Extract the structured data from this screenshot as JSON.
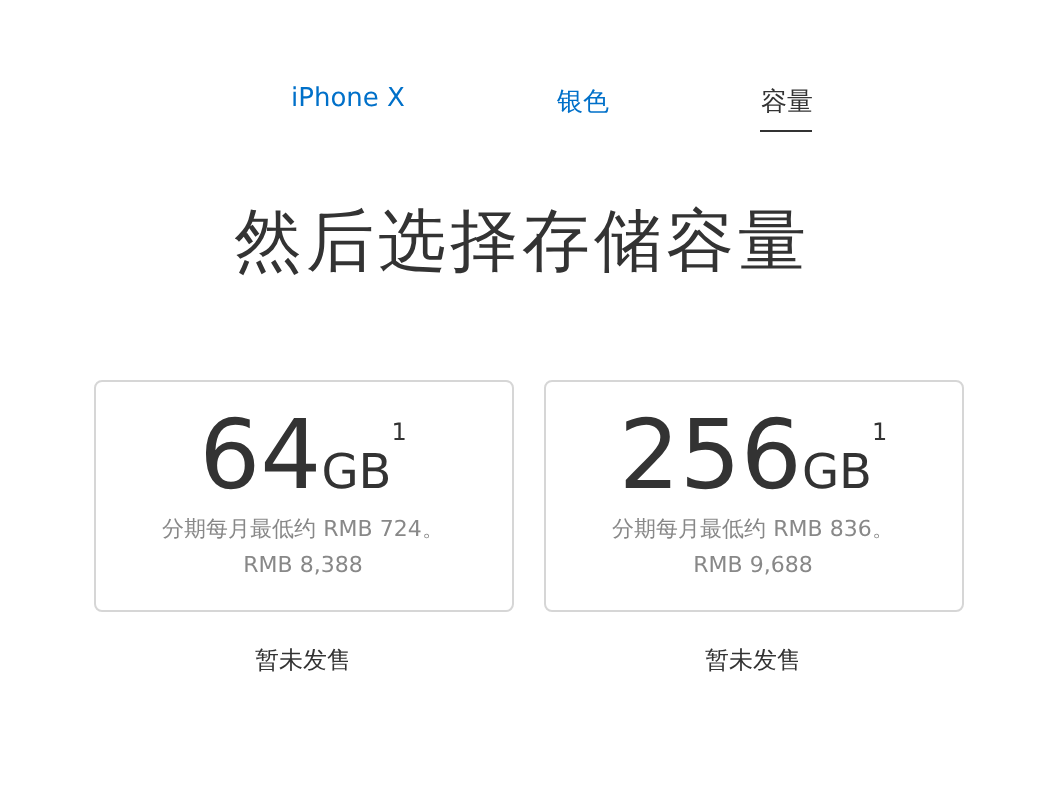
{
  "tabs": [
    {
      "label": "iPhone X",
      "selected": false
    },
    {
      "label": "银色",
      "selected": false
    },
    {
      "label": "容量",
      "selected": true
    }
  ],
  "title": "然后选择存储容量",
  "options": [
    {
      "size": "64",
      "unit": "GB",
      "note": "1",
      "monthly": "分期每月最低约 RMB 724。",
      "price": "RMB 8,388",
      "status": "暂未发售"
    },
    {
      "size": "256",
      "unit": "GB",
      "note": "1",
      "monthly": "分期每月最低约 RMB 836。",
      "price": "RMB 9,688",
      "status": "暂未发售"
    }
  ]
}
